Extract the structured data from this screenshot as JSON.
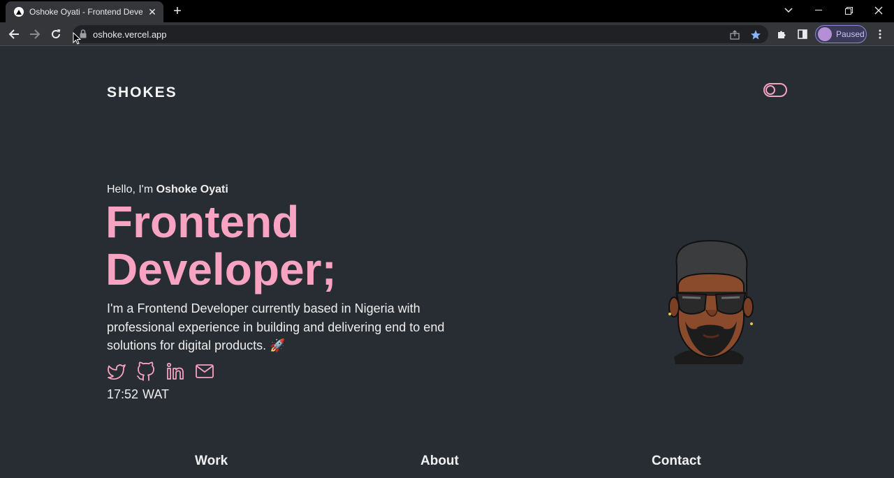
{
  "browser": {
    "tab_title": "Oshoke Oyati - Frontend Developer",
    "url": "oshoke.vercel.app",
    "profile_status": "Paused"
  },
  "site": {
    "brand": "SHOKES",
    "greeting_prefix": "Hello, I'm ",
    "greeting_name": "Oshoke Oyati",
    "headline_line1": "Frontend",
    "headline_line2": "Developer;",
    "description": "I'm a Frontend Developer currently based in Nigeria with professional experience in building and delivering end to end solutions for digital products. 🚀",
    "social_icons": [
      "twitter-icon",
      "github-icon",
      "linkedin-icon",
      "mail-icon"
    ],
    "clock_time": "17:52",
    "clock_zone": "WAT",
    "nav": [
      "Work",
      "About",
      "Contact"
    ]
  },
  "colors": {
    "background": "#282c33",
    "accent": "#f7a3c1",
    "text": "#eeeeee"
  }
}
